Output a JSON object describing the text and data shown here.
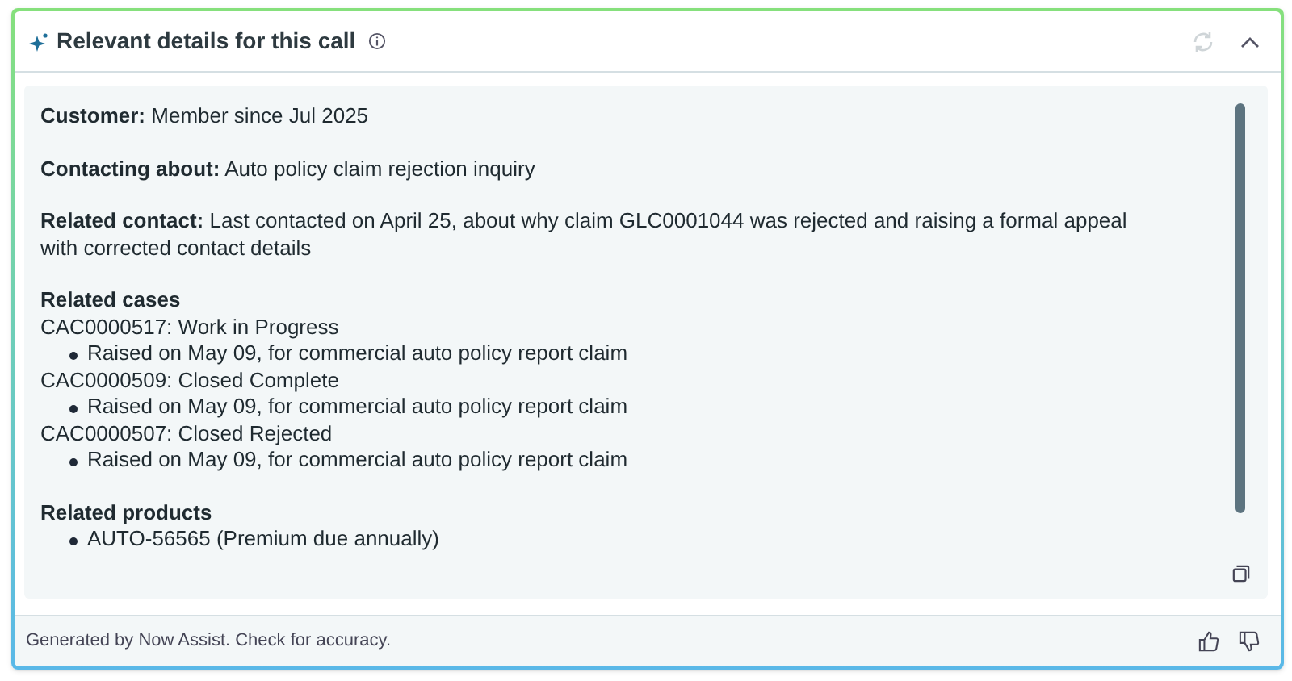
{
  "header": {
    "title": "Relevant details for this call"
  },
  "fields": [
    {
      "label": "Customer:",
      "text": "Member since Jul 2025"
    },
    {
      "label": "Contacting about:",
      "text": "Auto policy claim rejection inquiry"
    },
    {
      "label": "Related contact:",
      "text": "Last contacted on April 25, about why claim GLC0001044 was rejected and raising a formal appeal with corrected contact details"
    }
  ],
  "related_cases": {
    "heading": "Related cases",
    "items": [
      {
        "title": "CAC0000517: Work in Progress",
        "bullets": [
          "Raised on May 09, for commercial auto policy report claim"
        ]
      },
      {
        "title": "CAC0000509: Closed Complete",
        "bullets": [
          "Raised on May 09, for commercial auto policy report claim"
        ]
      },
      {
        "title": "CAC0000507: Closed Rejected",
        "bullets": [
          "Raised on May 09, for commercial auto policy report claim"
        ]
      }
    ]
  },
  "related_products": {
    "heading": "Related products",
    "bullets": [
      "AUTO-56565 (Premium due annually)"
    ]
  },
  "footer": {
    "text": "Generated by Now Assist. Check for accuracy."
  }
}
